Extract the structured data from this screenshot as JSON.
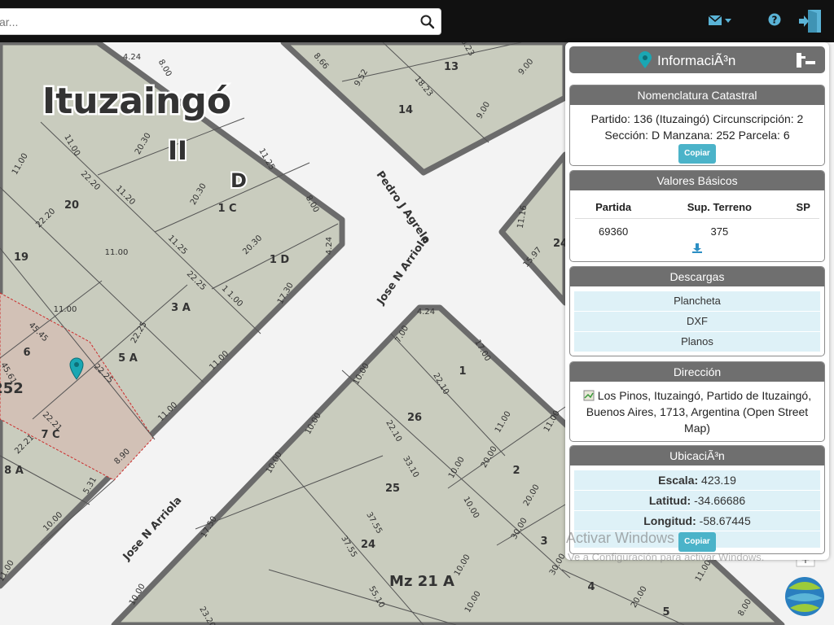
{
  "search": {
    "placeholder": "ar..."
  },
  "map": {
    "colors": {
      "block": "#c9ccbe",
      "road": "#f3f3f3",
      "outline": "#6b6b6b",
      "selected": "#d2c1b6"
    },
    "locality": "Ituzaingó",
    "circ": "II",
    "section": "D",
    "parcel_labels": [
      "20",
      "19",
      "1 C",
      "1 D",
      "3 A",
      "5 A",
      "6",
      "7 C",
      "8 A",
      "13",
      "14",
      "1",
      "26",
      "2",
      "25",
      "24",
      "3",
      "4",
      "5",
      "24"
    ],
    "block_labels": [
      "252",
      "Mz 21 A"
    ],
    "street_labels": [
      "Pedro J Agrelo",
      "Jose N Arriola",
      "Jose N Arriola"
    ],
    "dimension_labels": [
      "4.24",
      "8.00",
      "11.00",
      "20.30",
      "11.25",
      "11.00",
      "22.20",
      "11.20",
      "20.30",
      "8.00",
      "22.20",
      "11.25",
      "20.30",
      "4.24",
      "11.00",
      "11.00",
      "22.25",
      "1 1.00",
      "17.30",
      "11.00",
      "45.45",
      "22.25",
      "45.61",
      "22.25",
      "11.00",
      "22.21",
      "22.21",
      "8.90",
      "5.31",
      "10.00",
      "8.66",
      "9.52",
      "18.23",
      "18.23",
      "9.00",
      "9.00",
      "11.16",
      "15.97",
      "4.24",
      "7.00",
      "17.00",
      "10.00",
      "22.10",
      "10.00",
      "22.10",
      "33.10",
      "10.00",
      "20.00",
      "11.00",
      "10.00",
      "37.55",
      "37.55",
      "20.00",
      "30.00",
      "11.00",
      "17.50",
      "10.00",
      "55.10",
      "10.00",
      "30.00",
      "11.00",
      "10.00",
      "23.20",
      "20.00",
      "8.00",
      "10.00",
      "11.00"
    ]
  },
  "panel": {
    "title": "InformaciÃ³n",
    "nomenclatura": {
      "header": "Nomenclatura Catastral",
      "line1": "Partido: 136 (Ituzaingó) Circunscripción: 2",
      "line2": "Sección: D Manzana: 252 Parcela: 6",
      "copy": "Copiar"
    },
    "valores": {
      "header": "Valores Básicos",
      "col1": "Partida",
      "col2": "Sup. Terreno",
      "col3": "SP",
      "partida": "69360",
      "sup": "375",
      "sp": ""
    },
    "descargas": {
      "header": "Descargas",
      "items": [
        "Plancheta",
        "DXF",
        "Planos"
      ]
    },
    "direccion": {
      "header": "Dirección",
      "text": "Los Pinos, Ituzaingó, Partido de Ituzaingó, Buenos Aires, 1713, Argentina (Open Street Map)"
    },
    "ubicacion": {
      "header": "UbicaciÃ³n",
      "escala_label": "Escala:",
      "escala": "423.19",
      "lat_label": "Latitud:",
      "lat": "-34.66686",
      "lon_label": "Longitud:",
      "lon": "-58.67445",
      "copy": "Copiar"
    }
  },
  "watermark": {
    "line1": "Activar Windows",
    "line2": "Ve a Configuración para activar Windows."
  }
}
